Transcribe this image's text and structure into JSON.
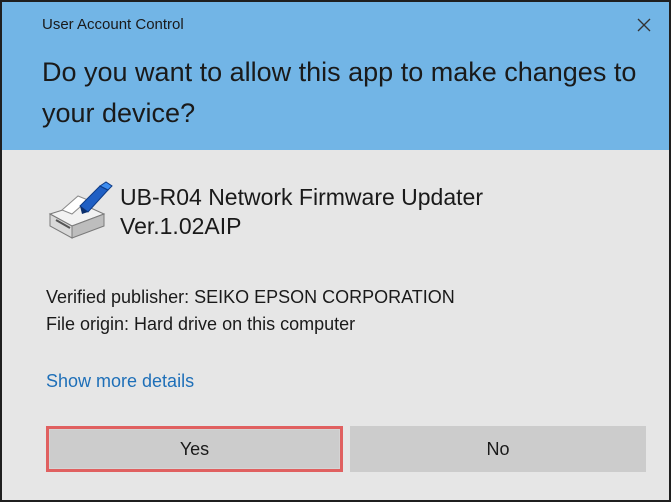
{
  "window": {
    "title": "User Account Control",
    "close_icon": "close-icon",
    "question": "Do you want to allow this app to make changes to your device?"
  },
  "app": {
    "icon": "printer-icon",
    "name_line1": "UB-R04 Network Firmware Updater",
    "name_line2": "Ver.1.02AIP"
  },
  "info": {
    "publisher": "Verified publisher: SEIKO EPSON CORPORATION",
    "origin": "File origin: Hard drive on this computer"
  },
  "details_link": "Show more details",
  "buttons": {
    "yes": "Yes",
    "no": "No"
  },
  "colors": {
    "header": "#72b5e6",
    "body": "#e6e6e6",
    "link": "#1e6fb8",
    "yes_focus_border": "#e06060",
    "button": "#cccccc"
  }
}
